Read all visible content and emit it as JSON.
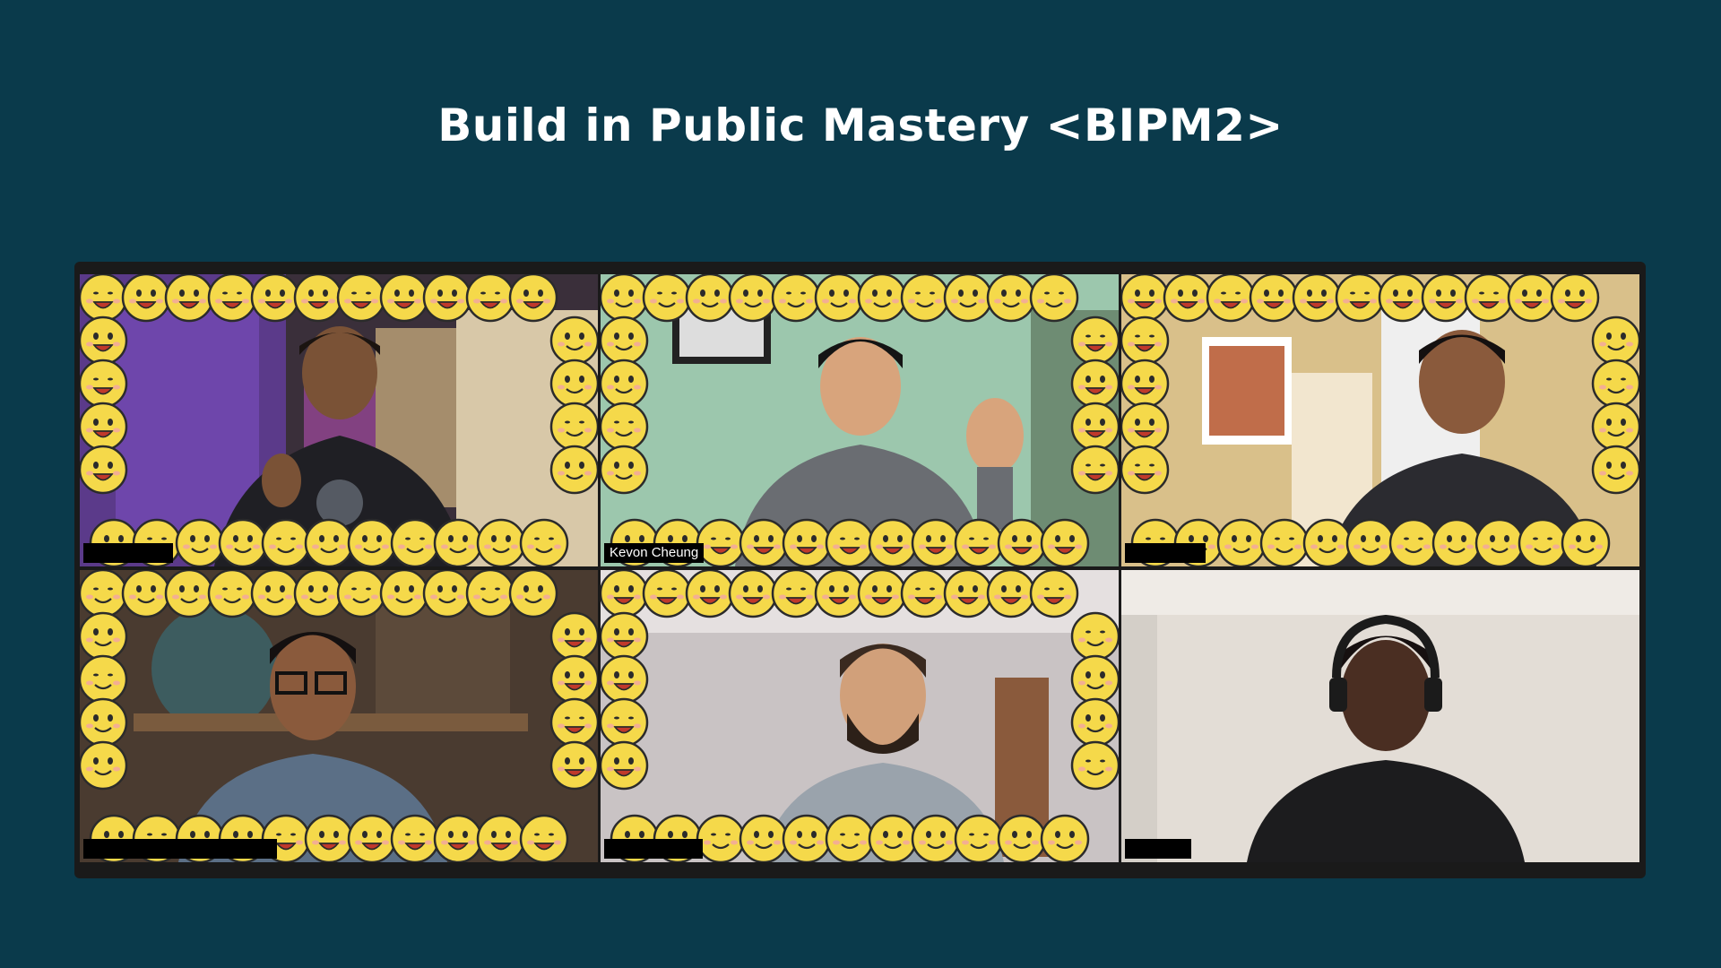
{
  "header": {
    "title": "Build in Public Mastery <BIPM2>"
  },
  "colors": {
    "background": "#0a3a4b",
    "frame": "#1a1a1a",
    "emoji_face": "#f5d94a",
    "emoji_outline": "#2b2b2b",
    "active_speaker_border": "#a8d15a"
  },
  "participants": [
    {
      "name": "",
      "background": "#5b3a8a",
      "emoji_frame": true,
      "active": true
    },
    {
      "name": "Kevon Cheung",
      "background": "#9cc7ad",
      "emoji_frame": true,
      "active": false
    },
    {
      "name": "",
      "background": "#d9c08a",
      "emoji_frame": true,
      "active": false
    },
    {
      "name": "",
      "background": "#6b5a46",
      "emoji_frame": true,
      "active": false
    },
    {
      "name": "",
      "background": "#c9c3c4",
      "emoji_frame": true,
      "active": false
    },
    {
      "name": "",
      "background": "#e3ddd6",
      "emoji_frame": false,
      "active": false
    }
  ]
}
